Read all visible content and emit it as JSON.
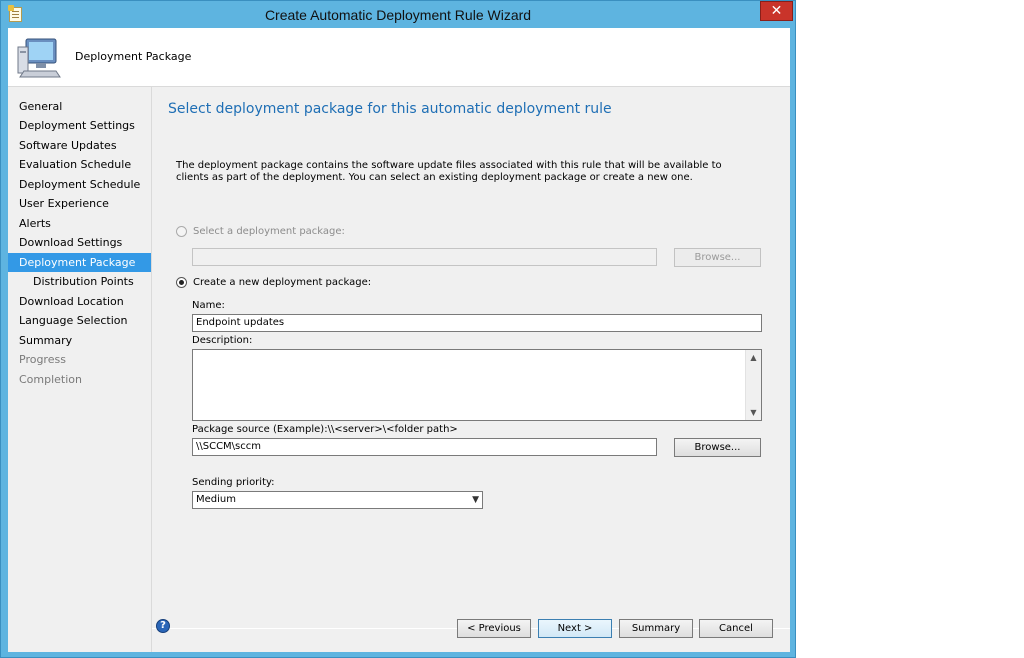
{
  "window": {
    "title": "Create Automatic Deployment Rule Wizard",
    "close_glyph": "✕"
  },
  "header": {
    "title": "Deployment Package",
    "icon": "computer-icon"
  },
  "nav": {
    "items": [
      {
        "label": "General",
        "state": "normal"
      },
      {
        "label": "Deployment Settings",
        "state": "normal"
      },
      {
        "label": "Software Updates",
        "state": "normal"
      },
      {
        "label": "Evaluation Schedule",
        "state": "normal"
      },
      {
        "label": "Deployment Schedule",
        "state": "normal"
      },
      {
        "label": "User Experience",
        "state": "normal"
      },
      {
        "label": "Alerts",
        "state": "normal"
      },
      {
        "label": "Download Settings",
        "state": "normal"
      },
      {
        "label": "Deployment Package",
        "state": "active"
      },
      {
        "label": "Distribution Points",
        "state": "sub"
      },
      {
        "label": "Download Location",
        "state": "normal"
      },
      {
        "label": "Language Selection",
        "state": "normal"
      },
      {
        "label": "Summary",
        "state": "normal"
      },
      {
        "label": "Progress",
        "state": "disabled"
      },
      {
        "label": "Completion",
        "state": "disabled"
      }
    ]
  },
  "page": {
    "heading": "Select deployment package for this automatic deployment rule",
    "description": "The deployment package contains the software update files associated with this rule that will be available to clients as part of the deployment. You can select an existing deployment package or create a new one.",
    "select_existing_label": "Select a deployment package:",
    "select_existing_value": "",
    "browse_existing_label": "Browse...",
    "create_new_label": "Create a new deployment package:",
    "name_label": "Name:",
    "name_value": "Endpoint updates",
    "description_label": "Description:",
    "description_value": "",
    "source_label": "Package source (Example):\\\\<server>\\<folder path>",
    "source_value": "\\\\SCCM\\sccm",
    "browse_source_label": "Browse...",
    "priority_label": "Sending priority:",
    "priority_value": "Medium",
    "selected_option": "create-new"
  },
  "footer": {
    "previous_label": "< Previous",
    "next_label": "Next >",
    "summary_label": "Summary",
    "cancel_label": "Cancel",
    "help_glyph": "?"
  },
  "colors": {
    "window_frame": "#5eb4e0",
    "heading": "#1f6fb5",
    "nav_active": "#3399e6",
    "close_button": "#c9342a"
  }
}
